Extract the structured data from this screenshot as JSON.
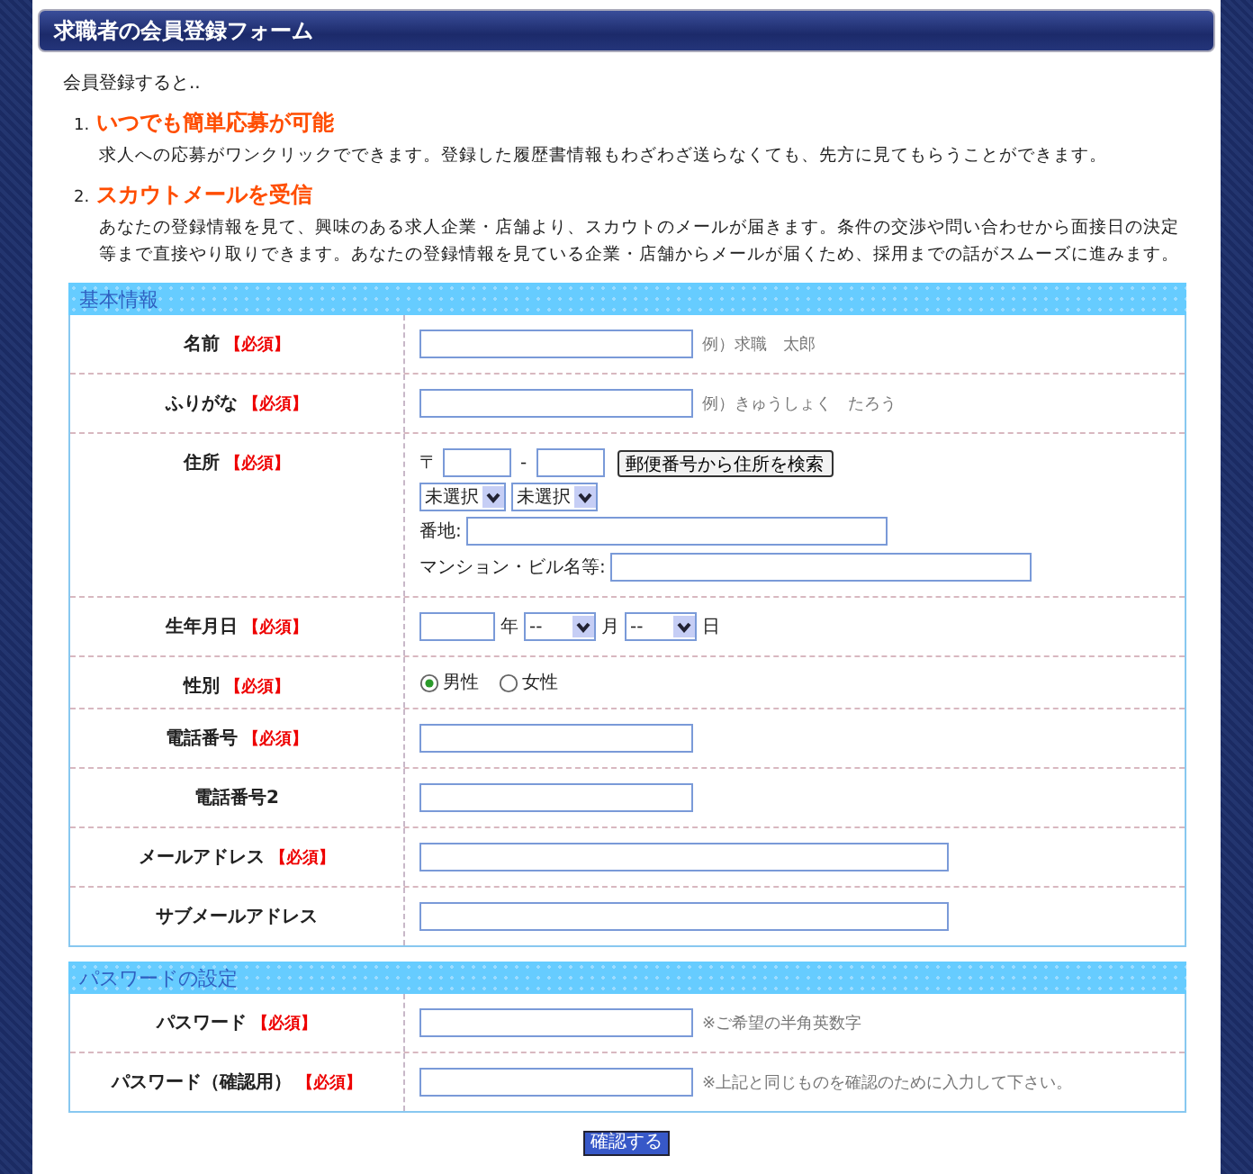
{
  "header": {
    "title": "求職者の会員登録フォーム"
  },
  "intro": {
    "lead": "会員登録すると..",
    "benefits": [
      {
        "number": "1.",
        "title": "いつでも簡単応募が可能",
        "text": "求人への応募がワンクリックでできます。登録した履歴書情報もわざわざ送らなくても、先方に見てもらうことができます。"
      },
      {
        "number": "2.",
        "title": "スカウトメールを受信",
        "text": "あなたの登録情報を見て、興味のある求人企業・店舗より、スカウトのメールが届きます。条件の交渉や問い合わせから面接日の決定等まで直接やり取りできます。あなたの登録情報を見ている企業・店舗からメールが届くため、採用までの話がスムーズに進みます。"
      }
    ]
  },
  "sections": [
    {
      "title": "基本情報",
      "rows": [
        {
          "label": "名前",
          "required_mark": "【必須】",
          "kind": "text",
          "note": "例）求職　太郎"
        },
        {
          "label": "ふりがな",
          "required_mark": "【必須】",
          "kind": "text",
          "note": "例）きゅうしょく　たろう"
        },
        {
          "label": "住所",
          "required_mark": "【必須】",
          "kind": "address",
          "postal_mark": "〒",
          "dash": "-",
          "lookup_button": "郵便番号から住所を検索",
          "selects": [
            "未選択",
            "未選択"
          ],
          "fields": [
            "番地:",
            "マンション・ビル名等:"
          ]
        },
        {
          "label": "生年月日",
          "required_mark": "【必須】",
          "kind": "date",
          "parts": [
            {
              "kind": "field"
            },
            {
              "kind": "text",
              "text": "年"
            },
            {
              "kind": "select",
              "value": "--"
            },
            {
              "kind": "text",
              "text": "月"
            },
            {
              "kind": "select",
              "value": "--"
            },
            {
              "kind": "text",
              "text": "日"
            }
          ]
        },
        {
          "label": "性別",
          "required_mark": "【必須】",
          "kind": "radio",
          "options": [
            {
              "label": "男性",
              "selected": true
            },
            {
              "label": "女性",
              "selected": false
            }
          ]
        },
        {
          "label": "電話番号",
          "required_mark": "【必須】",
          "kind": "text"
        },
        {
          "label": "電話番号2",
          "kind": "text"
        },
        {
          "label": "メールアドレス",
          "required_mark": "【必須】",
          "kind": "wide_text"
        },
        {
          "label": "サブメールアドレス",
          "kind": "wide_text"
        }
      ]
    },
    {
      "title": "パスワードの設定",
      "rows": [
        {
          "label": "パスワード",
          "required_mark": "【必須】",
          "kind": "text",
          "note": "※ご希望の半角英数字"
        },
        {
          "label": "パスワード（確認用）",
          "required_mark": "【必須】",
          "kind": "text",
          "note": "※上記と同じものを確認のために入力して下さい。"
        }
      ]
    }
  ],
  "submit": {
    "label": "確認する"
  }
}
